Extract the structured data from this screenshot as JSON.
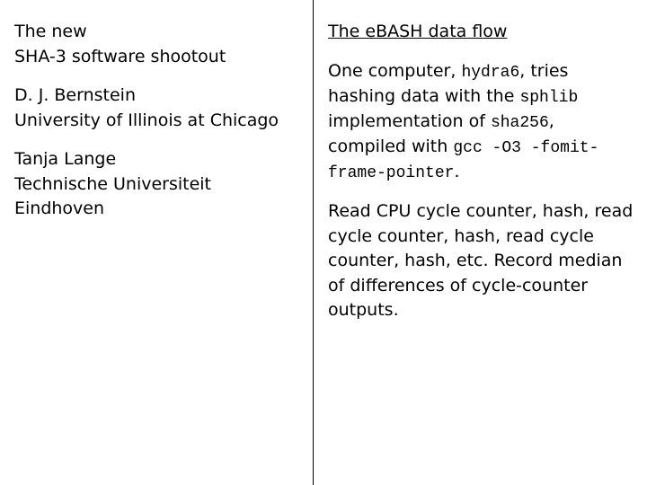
{
  "left": {
    "title_line1": "The new",
    "title_line2": "SHA-3 software shootout",
    "author1_name": "D. J. Bernstein",
    "author1_affil": "University of Illinois at Chicago",
    "author2_name": "Tanja Lange",
    "author2_affil": "Technische Universiteit Eindhoven"
  },
  "right": {
    "heading": "The eBASH data flow",
    "p1_a": "One computer, ",
    "p1_code1": "hydra6",
    "p1_b": ", tries hashing data with the ",
    "p1_code2": "sphlib",
    "p1_c": " implementation of ",
    "p1_code3": "sha256",
    "p1_d": ", compiled with ",
    "p1_code4": "gcc -O3 -fomit-frame-pointer",
    "p1_e": ".",
    "p2": "Read CPU cycle counter, hash, read cycle counter, hash, read cycle counter, hash, etc. Record median of differences of cycle-counter outputs."
  }
}
